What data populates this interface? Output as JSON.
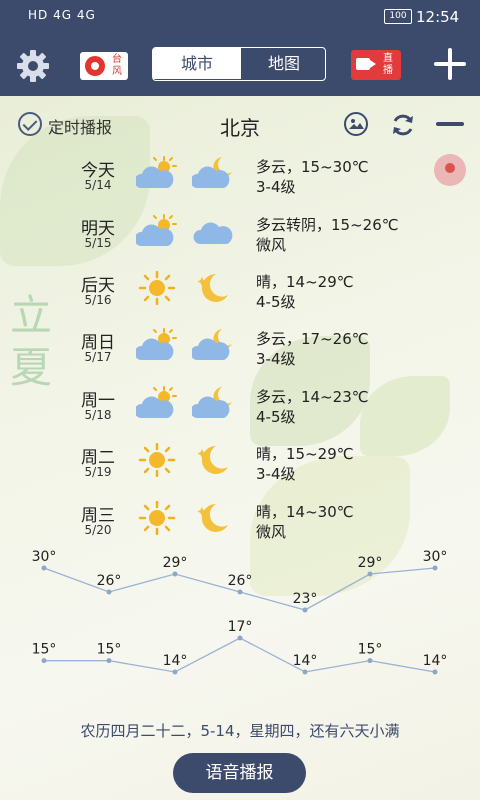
{
  "status_bar": {
    "left": "HD 4G 4G",
    "battery": "100",
    "time": "12:54"
  },
  "toolbar": {
    "typhoon_label": "台风",
    "tabs": [
      {
        "label": "城市"
      },
      {
        "label": "地图"
      }
    ],
    "live_label": "直播"
  },
  "header": {
    "timer_label": "定时播报",
    "city": "北京"
  },
  "solar_term": "立夏",
  "forecast": [
    {
      "day": "今天",
      "date": "5/14",
      "day_icon": "partly-cloudy-sun-icon",
      "night_icon": "partly-cloudy-moon-icon",
      "desc": "多云，15~30℃",
      "wind": "3-4级"
    },
    {
      "day": "明天",
      "date": "5/15",
      "day_icon": "partly-cloudy-sun-icon",
      "night_icon": "cloud-icon",
      "desc": "多云转阴，15~26℃",
      "wind": "微风"
    },
    {
      "day": "后天",
      "date": "5/16",
      "day_icon": "sun-icon",
      "night_icon": "moon-icon",
      "desc": "晴，14~29℃",
      "wind": "4-5级"
    },
    {
      "day": "周日",
      "date": "5/17",
      "day_icon": "partly-cloudy-sun-icon",
      "night_icon": "partly-cloudy-moon-icon",
      "desc": "多云，17~26℃",
      "wind": "3-4级"
    },
    {
      "day": "周一",
      "date": "5/18",
      "day_icon": "partly-cloudy-sun-icon",
      "night_icon": "partly-cloudy-moon-icon",
      "desc": "多云，14~23℃",
      "wind": "4-5级"
    },
    {
      "day": "周二",
      "date": "5/19",
      "day_icon": "sun-icon",
      "night_icon": "moon-icon",
      "desc": "晴，15~29℃",
      "wind": "3-4级"
    },
    {
      "day": "周三",
      "date": "5/20",
      "day_icon": "sun-icon",
      "night_icon": "moon-icon",
      "desc": "晴，14~30℃",
      "wind": "微风"
    }
  ],
  "chart_data": {
    "type": "line",
    "x": [
      "5/14",
      "5/15",
      "5/16",
      "5/17",
      "5/18",
      "5/19",
      "5/20"
    ],
    "series": [
      {
        "values": [
          30,
          26,
          29,
          26,
          23,
          29,
          30
        ]
      },
      {
        "values": [
          15,
          15,
          14,
          17,
          14,
          15,
          14
        ]
      }
    ],
    "unit": "°",
    "line_color": "#9bb2d6",
    "point_color": "#8fa6c8"
  },
  "footer": {
    "lunar_info": "农历四月二十二，5-14，星期四，还有六天小满",
    "voice_button": "语音播报"
  },
  "colors": {
    "primary": "#3c4a6b",
    "live": "#e23b3b",
    "typhoon": "#e3342f"
  }
}
